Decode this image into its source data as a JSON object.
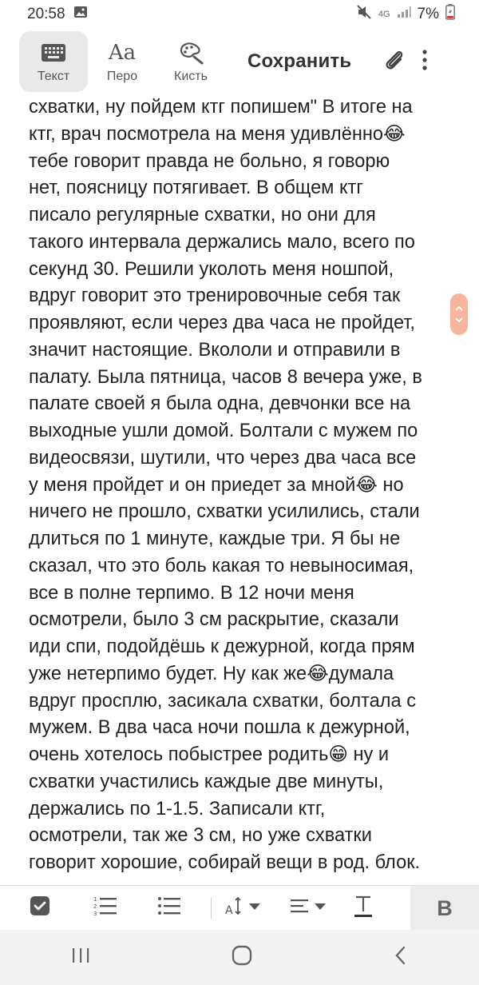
{
  "status": {
    "time": "20:58",
    "network": "4G",
    "battery": "7%"
  },
  "toolbar": {
    "tools": [
      {
        "label": "Текст"
      },
      {
        "label": "Перо"
      },
      {
        "label": "Кисть"
      }
    ],
    "save_label": "Сохранить"
  },
  "note": {
    "lines": [
      "схватки, ну пойдем ктг попишем\" В итоге на",
      "ктг, врач посмотрела на меня удивлённо😂",
      "тебе говорит правда не больно, я говорю",
      "нет, поясницу потягивает. В общем ктг",
      "писало регулярные схватки, но они для",
      "такого интервала держались мало, всего по",
      "секунд 30. Решили уколоть меня ношпой,",
      "вдруг говорит это тренировочные себя так",
      "проявляют, если через два часа не пройдет,",
      "значит настоящие. Вкололи  и отправили в",
      "палату. Была пятница, часов 8 вечера уже, в",
      "палате своей я была одна, девчонки все на",
      "выходные ушли домой. Болтали с мужем по",
      "видеосвязи, шутили, что через два часа все",
      "у меня пройдет и он приедет за  мной😂 но",
      "ничего не прошло, схватки усилились, стали",
      "длиться по 1 минуте, каждые три. Я бы не",
      "сказал, что это боль какая то невыносимая,",
      "все в полне терпимо. В 12 ночи  меня",
      "осмотрели, было 3 см раскрытие, сказали",
      "иди спи, подойдёшь к дежурной, когда прям",
      "уже нетерпимо будет. Ну как же😂думала",
      "вдруг просплю, засикала схватки, болтала с",
      "мужем. В два часа ночи пошла к дежурной,",
      "очень хотелось побыстрее родить😁 ну и",
      "схватки участились каждые две минуты,",
      "держались по 1-1.5. Записали ктг,",
      "осмотрели, так же 3 см, но уже схватки",
      "говорит хорошие, собирай вещи в род. блок."
    ]
  },
  "format_bar": {
    "bold_label": "B"
  },
  "colors": {
    "scroll_handle": "#f6b59d",
    "active_tool_bg": "#e9e9e9"
  }
}
